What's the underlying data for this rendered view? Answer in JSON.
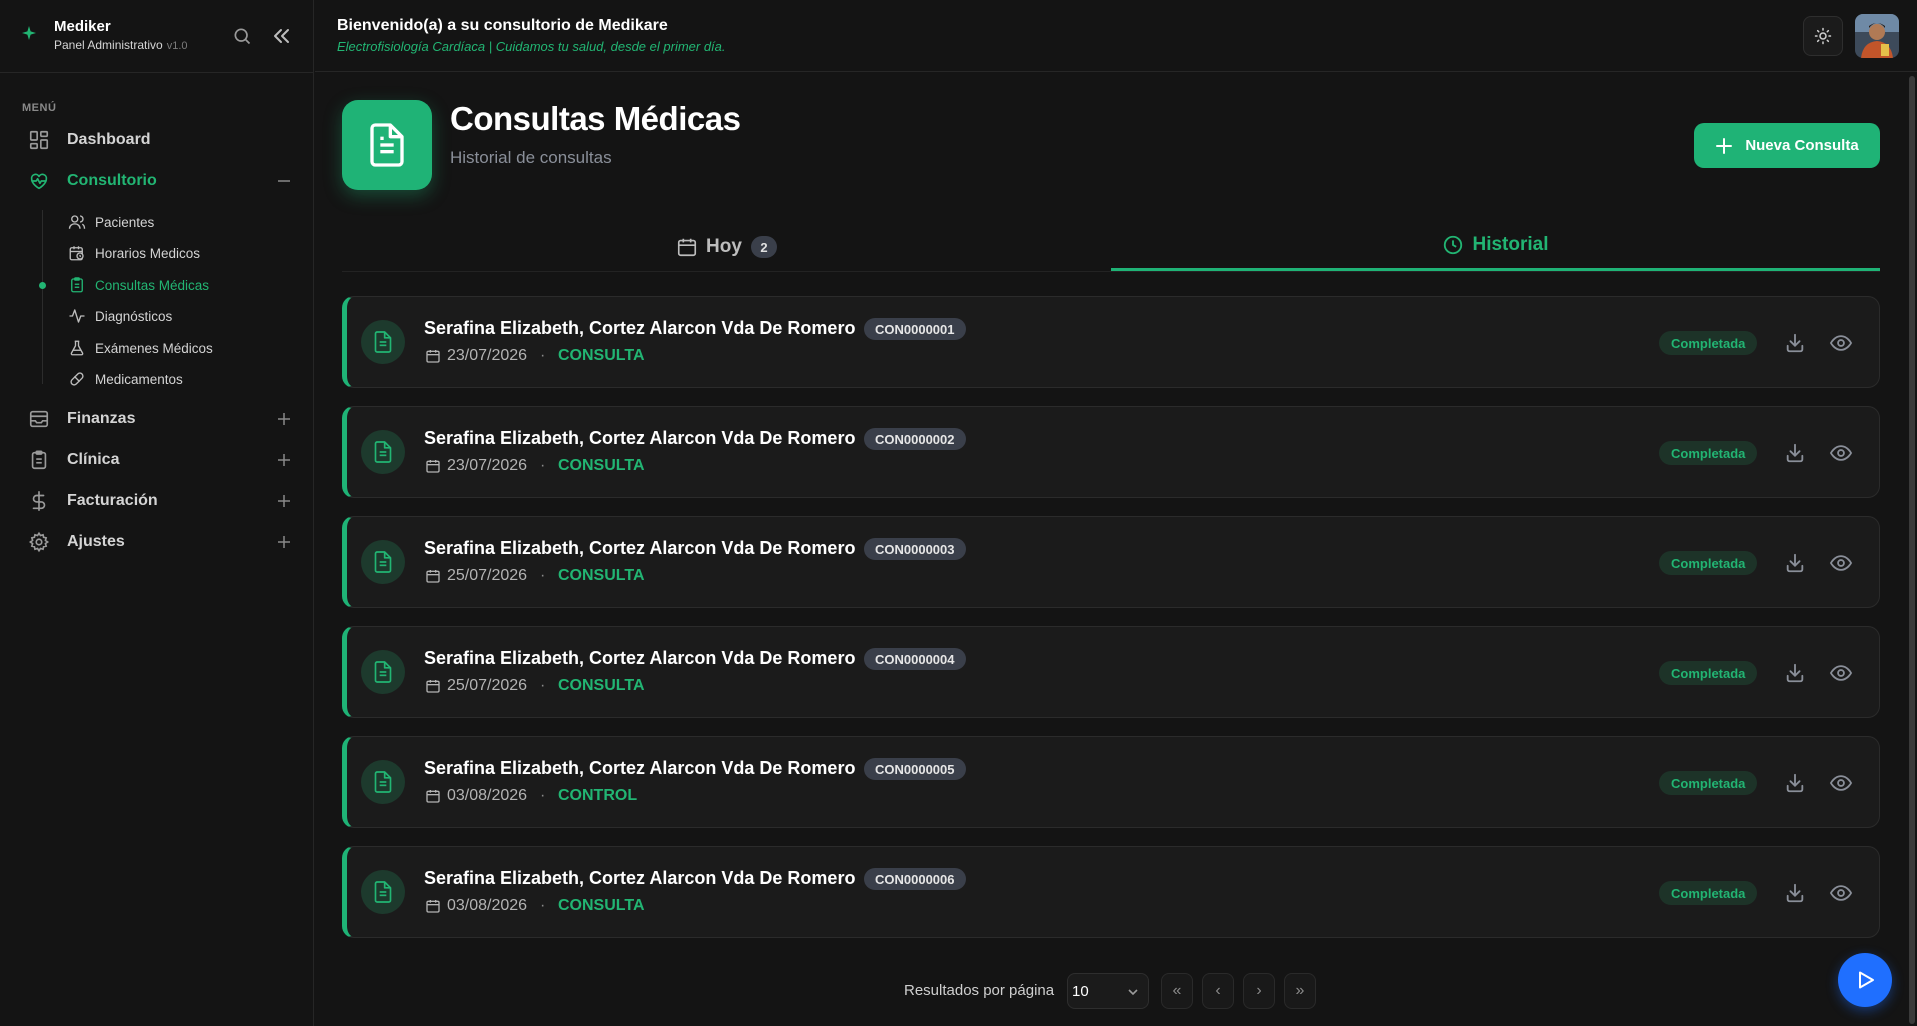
{
  "brand": {
    "name": "Mediker",
    "subtitle": "Panel Administrativo",
    "version": "v1.0"
  },
  "sidebar": {
    "menu_label": "MENÚ",
    "items": [
      {
        "label": "Dashboard",
        "icon": "grid-icon"
      },
      {
        "label": "Consultorio",
        "icon": "heart-pulse-icon",
        "active": true,
        "expanded": true
      },
      {
        "label": "Finanzas",
        "icon": "wallet-icon"
      },
      {
        "label": "Clínica",
        "icon": "clipboard-icon"
      },
      {
        "label": "Facturación",
        "icon": "dollar-icon"
      },
      {
        "label": "Ajustes",
        "icon": "gear-icon"
      }
    ],
    "sub_items": [
      {
        "label": "Pacientes",
        "icon": "users-icon"
      },
      {
        "label": "Horarios Medicos",
        "icon": "calendar-clock-icon"
      },
      {
        "label": "Consultas Médicas",
        "icon": "clipboard-list-icon",
        "active": true
      },
      {
        "label": "Diagnósticos",
        "icon": "activity-icon"
      },
      {
        "label": "Exámenes Médicos",
        "icon": "flask-icon"
      },
      {
        "label": "Medicamentos",
        "icon": "pill-icon"
      }
    ]
  },
  "header": {
    "title": "Bienvenido(a) a su consultorio de Medikare",
    "subtitle": "Electrofisiología Cardíaca | Cuidamos tu salud, desde el primer día."
  },
  "page": {
    "title": "Consultas Médicas",
    "subtitle": "Historial de consultas",
    "new_button": "Nueva Consulta"
  },
  "tabs": {
    "hoy": {
      "label": "Hoy",
      "count": "2"
    },
    "historial": {
      "label": "Historial",
      "active": true
    }
  },
  "consultas": [
    {
      "name": "Serafina Elizabeth, Cortez Alarcon Vda De Romero",
      "code": "CON0000001",
      "date": "23/07/2026",
      "type": "CONSULTA",
      "status": "Completada"
    },
    {
      "name": "Serafina Elizabeth, Cortez Alarcon Vda De Romero",
      "code": "CON0000002",
      "date": "23/07/2026",
      "type": "CONSULTA",
      "status": "Completada"
    },
    {
      "name": "Serafina Elizabeth, Cortez Alarcon Vda De Romero",
      "code": "CON0000003",
      "date": "25/07/2026",
      "type": "CONSULTA",
      "status": "Completada"
    },
    {
      "name": "Serafina Elizabeth, Cortez Alarcon Vda De Romero",
      "code": "CON0000004",
      "date": "25/07/2026",
      "type": "CONSULTA",
      "status": "Completada"
    },
    {
      "name": "Serafina Elizabeth, Cortez Alarcon Vda De Romero",
      "code": "CON0000005",
      "date": "03/08/2026",
      "type": "CONTROL",
      "status": "Completada"
    },
    {
      "name": "Serafina Elizabeth, Cortez Alarcon Vda De Romero",
      "code": "CON0000006",
      "date": "03/08/2026",
      "type": "CONSULTA",
      "status": "Completada"
    }
  ],
  "separator": "·",
  "pagination": {
    "label": "Resultados por página",
    "per_page": "10",
    "first": "«",
    "prev": "‹",
    "next": "›",
    "last": "»"
  },
  "colors": {
    "accent": "#1fb376",
    "background": "#141414",
    "card": "#1b1b1b",
    "fab": "#1f6fff"
  }
}
